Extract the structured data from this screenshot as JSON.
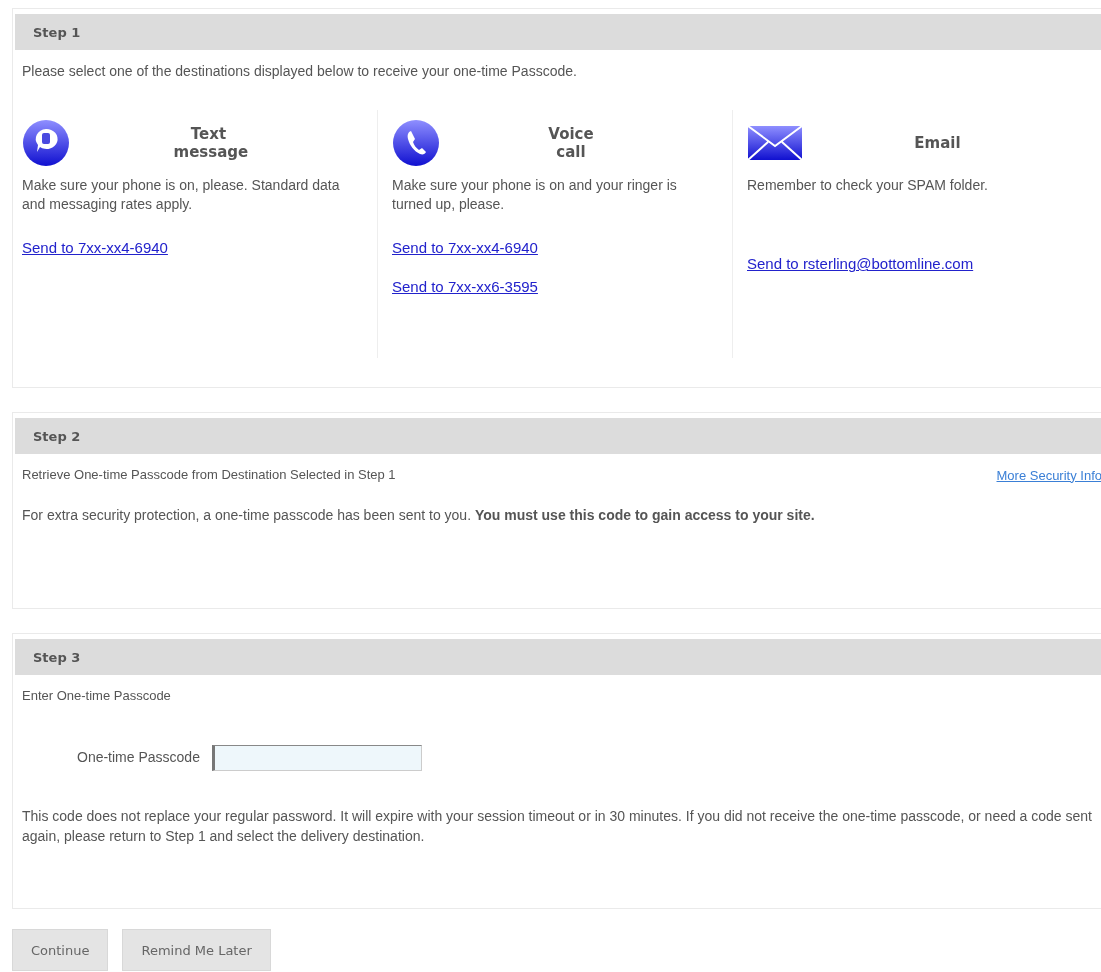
{
  "steps": [
    {
      "kind": "destinations",
      "title": "Step 1",
      "intro": "Please select one of the destinations displayed below to receive your one-time Passcode.",
      "destinations": [
        {
          "kind": "text",
          "title": "Text message",
          "description": "Make sure your phone is on, please. Standard data and messaging rates apply.",
          "links": [
            "Send to 7xx-xx4-6940"
          ]
        },
        {
          "kind": "voice",
          "title": "Voice call",
          "description": "Make sure your phone is on and your ringer is turned up, please.",
          "links": [
            "Send to 7xx-xx4-6940",
            "Send to 7xx-xx6-3595"
          ]
        },
        {
          "kind": "email",
          "title": "Email",
          "description": "Remember to check your SPAM folder.",
          "links": [
            "Send to rsterling@bottomline.com"
          ]
        }
      ]
    },
    {
      "kind": "info",
      "title": "Step 2",
      "subtitle": "Retrieve One-time Passcode from Destination Selected in Step 1",
      "link": "More Security Info",
      "text": "For extra security protection, a one-time passcode has been sent to you. **You must use this code to gain access to your site.**"
    },
    {
      "kind": "entry",
      "title": "Step 3",
      "subtitle": "Enter One-time Passcode",
      "field_label": "One-time Passcode",
      "note": "This code does not replace your regular password. It will expire with your session timeout or in 30 minutes. If you did not receive the one-time passcode, or need a code sent again, please return to Step 1 and select the delivery destination."
    }
  ],
  "buttons": [
    "Continue",
    "Remind Me Later"
  ]
}
